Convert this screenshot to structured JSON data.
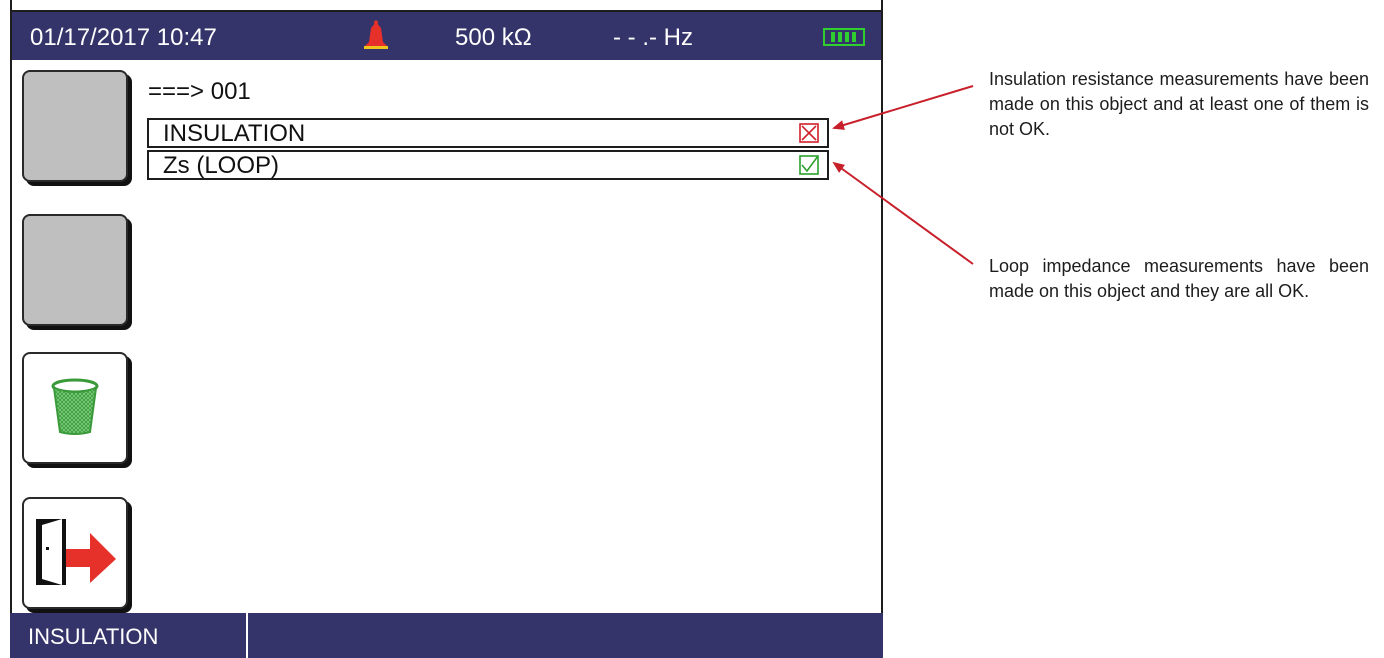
{
  "status_bar": {
    "datetime": "01/17/2017 10:47",
    "voltage": "500  kΩ",
    "frequency": "- - .-  Hz",
    "bell_icon": "alarm-bell-icon",
    "battery_icon": "battery-full-icon"
  },
  "object": {
    "title": "===> 001",
    "rows": [
      {
        "label": "INSULATION",
        "status": "fail"
      },
      {
        "label": "Zs (LOOP)",
        "status": "ok"
      }
    ]
  },
  "bottom_bar": {
    "label": "INSULATION"
  },
  "annotations": [
    "Insulation resistance measurements have been made on this object and at least one of them is not OK.",
    "Loop impedance measurements have been made on this object and they are all OK."
  ],
  "colors": {
    "bar_bg": "#34346a",
    "fail": "#d0202a",
    "ok": "#2da02d",
    "arrow": "#c8202a"
  }
}
